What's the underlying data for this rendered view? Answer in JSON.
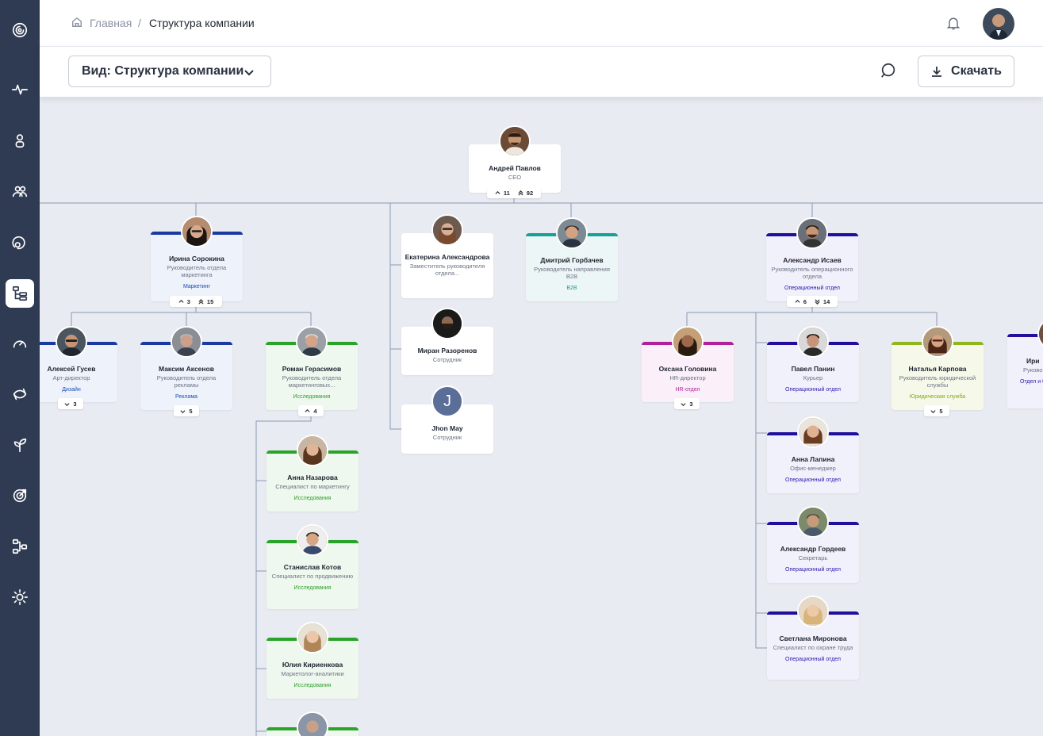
{
  "breadcrumb": {
    "home": "Главная",
    "separator": "/",
    "current": "Структура компании"
  },
  "toolbar": {
    "view_label": "Вид: Структура компании",
    "download_label": "Скачать"
  },
  "sidebar": {
    "items": [
      "logo-icon",
      "pulse-icon",
      "profile-icon",
      "team-icon",
      "feedback-icon",
      "org-structure-icon",
      "performance-icon",
      "sync-icon",
      "growth-icon",
      "goals-icon",
      "workflow-icon",
      "settings-icon"
    ],
    "active": "org-structure-icon"
  },
  "colors": {
    "sidebar": "#2f3b52",
    "canvas": "#e8ebf1",
    "marketing": "#1a3aa0",
    "research": "#29a329",
    "b2b": "#17a097",
    "operations": "#1f0f9c",
    "hr": "#b01f9c",
    "legal": "#8fb51f"
  },
  "cards": [
    {
      "id": "ceo",
      "name": "Андрей Павлов",
      "position": "CEO",
      "department": "",
      "color": "none",
      "bg": "#ffffff",
      "counter": {
        "up": "11",
        "total": "92"
      }
    },
    {
      "id": "sorokina",
      "name": "Ирина Сорокина",
      "position": "Руководитель отдела маркетинга",
      "department": "Маркетинг",
      "color": "#1a3aa0",
      "dept_color": "#1a4fb5",
      "bg": "#eef2fb",
      "counter": {
        "up": "3",
        "total": "15"
      }
    },
    {
      "id": "aleksandrova",
      "name": "Екатерина Александрова",
      "position": "Заместитель руководителя отдела...",
      "department": "",
      "color": "none",
      "bg": "#ffffff"
    },
    {
      "id": "razorenov",
      "name": "Миран Разоренов",
      "position": "Сотрудник",
      "department": "",
      "color": "none",
      "bg": "#ffffff"
    },
    {
      "id": "jhon",
      "name": "Jhon May",
      "position": "Сотрудник",
      "department": "",
      "color": "none",
      "bg": "#ffffff",
      "initial": "J"
    },
    {
      "id": "gorbachev",
      "name": "Дмитрий Горбачев",
      "position": "Руководитель направления B2B",
      "department": "B2B",
      "color": "#17a097",
      "dept_color": "#17a097",
      "bg": "#edf6f6"
    },
    {
      "id": "isaev",
      "name": "Александр Исаев",
      "position": "Руководитель операционного отдела",
      "department": "Операционный отдел",
      "color": "#1f0f9c",
      "dept_color": "#2a18b0",
      "bg": "#f1f1fb",
      "counter": {
        "up": "6",
        "total": "14"
      }
    },
    {
      "id": "gusev",
      "name": "Алексей Гусев",
      "position": "Арт-директор",
      "department": "Дизайн",
      "color": "#1a3aa0",
      "dept_color": "#1a4fb5",
      "bg": "#eef2fb",
      "counter": {
        "down": "3"
      }
    },
    {
      "id": "aksenov",
      "name": "Максим Аксенов",
      "position": "Руководитель отдела рекламы",
      "department": "Реклама",
      "color": "#1a3aa0",
      "dept_color": "#1a4fb5",
      "bg": "#eef2fb",
      "counter": {
        "down": "5"
      }
    },
    {
      "id": "gerasimov",
      "name": "Роман Герасимов",
      "position": "Руководитель отдела маркетинговых...",
      "department": "Исследования",
      "color": "#29a329",
      "dept_color": "#2c9e2c",
      "bg": "#eff8ee",
      "counter": {
        "up": "4"
      }
    },
    {
      "id": "nazarova",
      "name": "Анна Назарова",
      "position": "Специалист по маркетингу",
      "department": "Исследования",
      "color": "#29a329",
      "dept_color": "#2c9e2c",
      "bg": "#eff8ee"
    },
    {
      "id": "kotov",
      "name": "Станислав Котов",
      "position": "Специалист по продвижению",
      "department": "Исследования",
      "color": "#29a329",
      "dept_color": "#2c9e2c",
      "bg": "#eff8ee"
    },
    {
      "id": "kirienkova",
      "name": "Юлия Кириенкова",
      "position": "Маркетолог-аналитики",
      "department": "Исследования",
      "color": "#29a329",
      "dept_color": "#2c9e2c",
      "bg": "#eff8ee"
    },
    {
      "id": "golovina",
      "name": "Оксана Головина",
      "position": "HR-директор",
      "department": "HR-отдел",
      "color": "#b01f9c",
      "dept_color": "#b01f9c",
      "bg": "#fbf0f9",
      "counter": {
        "down": "3"
      }
    },
    {
      "id": "panin",
      "name": "Павел Панин",
      "position": "Курьер",
      "department": "Операционный отдел",
      "color": "#1f0f9c",
      "dept_color": "#2a18b0",
      "bg": "#f1f1fb"
    },
    {
      "id": "lapina",
      "name": "Анна Лапина",
      "position": "Офис-менеджер",
      "department": "Операционный отдел",
      "color": "#1f0f9c",
      "dept_color": "#2a18b0",
      "bg": "#f1f1fb"
    },
    {
      "id": "gordeev",
      "name": "Александр Гордеев",
      "position": "Секретарь",
      "department": "Операционный отдел",
      "color": "#1f0f9c",
      "dept_color": "#2a18b0",
      "bg": "#f1f1fb"
    },
    {
      "id": "mironova",
      "name": "Светлана Миронова",
      "position": "Специалист по охране труда",
      "department": "Операционный отдел",
      "color": "#1f0f9c",
      "dept_color": "#2a18b0",
      "bg": "#f1f1fb"
    },
    {
      "id": "karpova",
      "name": "Наталья Карпова",
      "position": "Руководитель юридической службы",
      "department": "Юридическая служба",
      "color": "#8fb51f",
      "dept_color": "#7fa80f",
      "bg": "#f6f9ea",
      "counter": {
        "down": "5"
      }
    },
    {
      "id": "partial",
      "name": "Ири",
      "position": "Руково инфо",
      "department": "Отдел и без",
      "color": "#1f0f9c",
      "dept_color": "#2a18b0",
      "bg": "#f1f1fb"
    }
  ]
}
